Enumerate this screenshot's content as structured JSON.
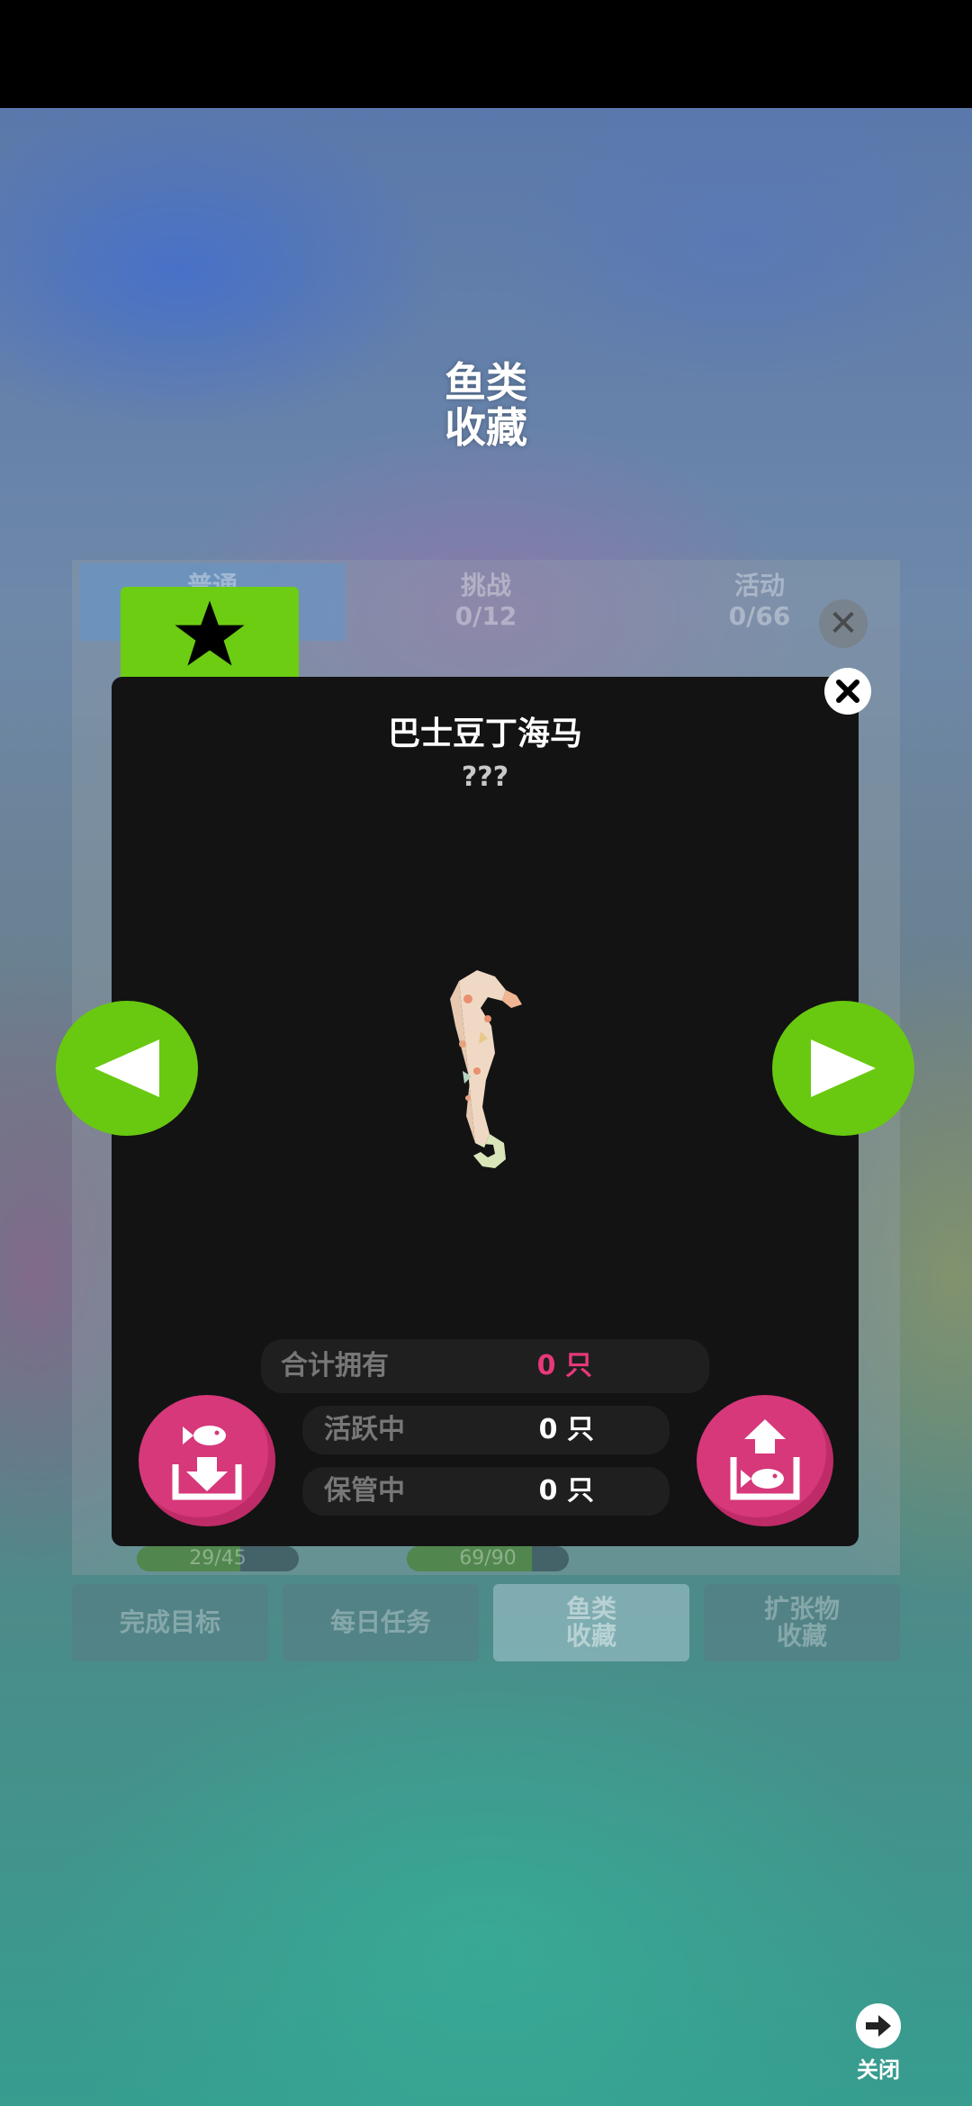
{
  "page": {
    "title": "鱼类\n收藏"
  },
  "background_tabs": [
    {
      "label": "普通",
      "count": "",
      "active": true
    },
    {
      "label": "挑战",
      "count": "0/12",
      "active": false
    },
    {
      "label": "活动",
      "count": "0/66",
      "active": false
    }
  ],
  "background_progress": [
    {
      "label": "29/45",
      "fraction": 0.64
    },
    {
      "label": "69/90",
      "fraction": 0.77
    }
  ],
  "bottom_nav": [
    {
      "label": "完成目标",
      "active": false
    },
    {
      "label": "每日任务",
      "active": false
    },
    {
      "label": "鱼类\n收藏",
      "active": true
    },
    {
      "label": "扩张物\n收藏",
      "active": false
    }
  ],
  "detail": {
    "name": "巴士豆丁海马",
    "subtitle": "???",
    "total_label": "合计拥有",
    "total_value": "0 只",
    "active_label": "活跃中",
    "active_value": "0 只",
    "storage_label": "保管中",
    "storage_value": "0 只"
  },
  "footer": {
    "close_label": "关闭"
  },
  "colors": {
    "accent_green": "#6ccd12",
    "accent_pink": "#d6387a",
    "count_red": "#e8387a"
  }
}
